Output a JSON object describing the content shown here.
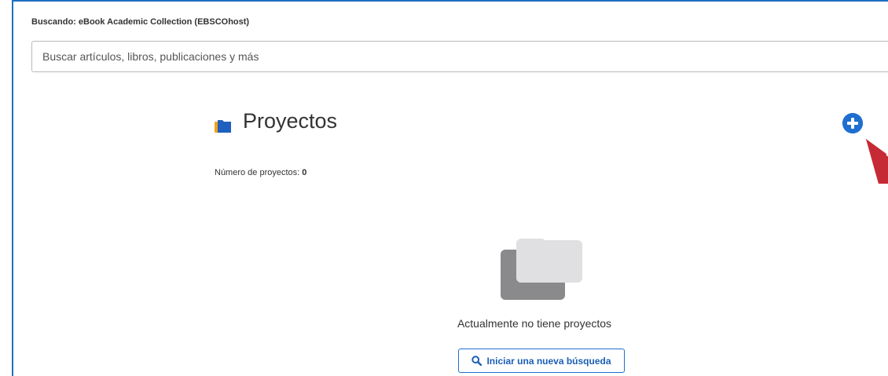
{
  "search": {
    "scope_label": "Buscando:  eBook Academic Collection (EBSCOhost)",
    "placeholder": "Buscar artículos, libros, publicaciones y más"
  },
  "projects": {
    "title": "Proyectos",
    "count_label": "Número de proyectos:",
    "count_value": "0",
    "empty_message": "Actualmente no tiene proyectos",
    "new_search_label": "Iniciar una nueva búsqueda",
    "icons": {
      "title": "folder-icon",
      "add": "plus-circle-icon",
      "empty": "empty-folder-icon",
      "new_search": "search-icon"
    }
  },
  "colors": {
    "accent": "#1f6fd0",
    "folder_orange": "#f0a21a",
    "folder_blue": "#1f5fbf",
    "annotation_arrow": "#c62a34"
  }
}
